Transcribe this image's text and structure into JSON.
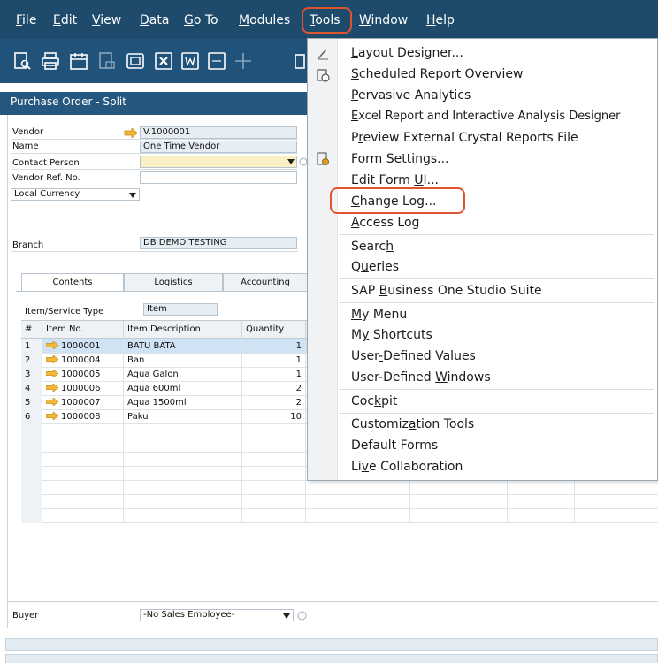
{
  "menubar": {
    "items": [
      {
        "pre": "",
        "u": "F",
        "post": "ile"
      },
      {
        "pre": "",
        "u": "E",
        "post": "dit"
      },
      {
        "pre": "",
        "u": "V",
        "post": "iew"
      },
      {
        "pre": "",
        "u": "D",
        "post": "ata"
      },
      {
        "pre": "",
        "u": "G",
        "post": "o To"
      },
      {
        "pre": "",
        "u": "M",
        "post": "odules"
      },
      {
        "pre": "",
        "u": "T",
        "post": "ools"
      },
      {
        "pre": "",
        "u": "W",
        "post": "indow"
      },
      {
        "pre": "",
        "u": "H",
        "post": "elp"
      }
    ]
  },
  "toolbar": {
    "icons": [
      "preview-icon",
      "print-icon",
      "print-preview-icon",
      "send-icon",
      "email-icon",
      "excel-icon",
      "word-icon",
      "pdf-icon",
      "move-icon",
      "more-icon"
    ]
  },
  "form": {
    "title": "Purchase Order - Split",
    "vendor_label": "Vendor",
    "vendor_value": "V.1000001",
    "name_label": "Name",
    "name_value": "One Time Vendor",
    "contact_label": "Contact Person",
    "contact_value": "",
    "vendor_ref_label": "Vendor Ref. No.",
    "vendor_ref_value": "",
    "currency_value": "Local Currency",
    "branch_label": "Branch",
    "branch_value": "DB DEMO TESTING",
    "tabs": [
      "Contents",
      "Logistics",
      "Accounting"
    ],
    "item_type_label": "Item/Service Type",
    "item_type_value": "Item",
    "buyer_label": "Buyer",
    "buyer_value": "-No Sales Employee-"
  },
  "grid": {
    "headers": [
      "#",
      "Item No.",
      "Item Description",
      "Quantity"
    ],
    "rows": [
      {
        "n": "1",
        "no": "1000001",
        "desc": "BATU BATA",
        "qty": "1"
      },
      {
        "n": "2",
        "no": "1000004",
        "desc": "Ban",
        "qty": "1"
      },
      {
        "n": "3",
        "no": "1000005",
        "desc": "Aqua Galon",
        "qty": "1"
      },
      {
        "n": "4",
        "no": "1000006",
        "desc": "Aqua 600ml",
        "qty": "2"
      },
      {
        "n": "5",
        "no": "1000007",
        "desc": "Aqua 1500ml",
        "qty": "2"
      },
      {
        "n": "6",
        "no": "1000008",
        "desc": "Paku",
        "qty": "10"
      }
    ]
  },
  "tools_menu": {
    "items": [
      {
        "pre": "",
        "u": "L",
        "post": "ayout Designer..."
      },
      {
        "pre": "",
        "u": "S",
        "post": "cheduled Report Overview"
      },
      {
        "pre": "",
        "u": "P",
        "post": "ervasive Analytics"
      },
      {
        "pre": "",
        "u": "E",
        "post": "xcel Report and Interactive Analysis Designer"
      },
      {
        "pre": "P",
        "u": "r",
        "post": "eview External Crystal Reports File"
      },
      {
        "pre": "",
        "u": "F",
        "post": "orm Settings..."
      },
      {
        "pre": "Edit Form ",
        "u": "U",
        "post": "I..."
      },
      {
        "pre": "",
        "u": "C",
        "post": "hange Log..."
      },
      {
        "pre": "",
        "u": "A",
        "post": "ccess Log"
      },
      {
        "pre": "Searc",
        "u": "h",
        "post": ""
      },
      {
        "pre": "Q",
        "u": "u",
        "post": "eries"
      },
      {
        "pre": "SAP ",
        "u": "B",
        "post": "usiness One Studio Suite"
      },
      {
        "pre": "",
        "u": "M",
        "post": "y Menu"
      },
      {
        "pre": "M",
        "u": "y",
        "post": " Shortcuts"
      },
      {
        "pre": "User",
        "u": "-",
        "post": "Defined Values"
      },
      {
        "pre": "User-Defined ",
        "u": "W",
        "post": "indows"
      },
      {
        "pre": "Coc",
        "u": "k",
        "post": "pit"
      },
      {
        "pre": "Customiz",
        "u": "a",
        "post": "tion Tools"
      },
      {
        "pre": "Default Forms",
        "u": "",
        "post": ""
      },
      {
        "pre": "Li",
        "u": "v",
        "post": "e Collaboration"
      }
    ]
  }
}
